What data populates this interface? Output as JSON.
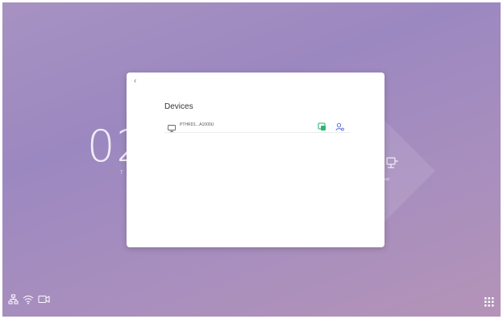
{
  "background": {
    "clock_text": "02",
    "clock_sub": "T",
    "right_label": "out"
  },
  "dialog": {
    "title": "Devices",
    "devices": [
      {
        "name": "PTHRD1...A1000U"
      }
    ]
  },
  "icons": {
    "back": "back-chevron-icon",
    "device": "monitor-icon",
    "share": "screen-share-icon",
    "user": "user-settings-icon",
    "network": "network-icon",
    "wifi": "wifi-icon",
    "camera": "camera-icon",
    "apps": "app-grid-icon"
  },
  "colors": {
    "accent": "#2bb673",
    "user_icon": "#5b6ee1",
    "bg_purple": "#a792c2"
  }
}
